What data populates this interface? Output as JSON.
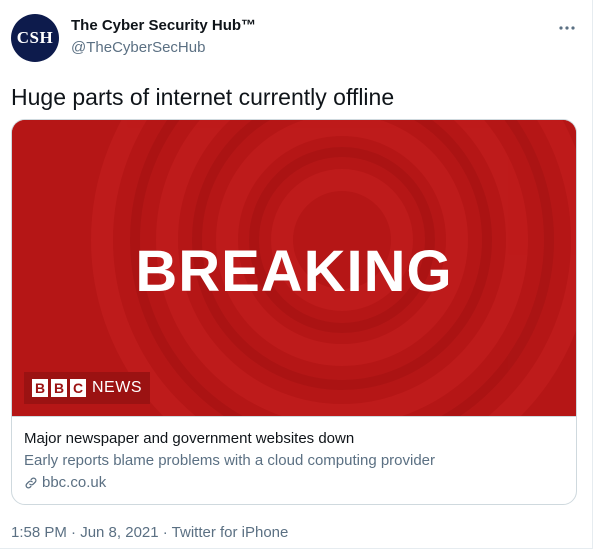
{
  "author": {
    "avatar_text": "CSH",
    "name": "The Cyber Security Hub™",
    "handle": "@TheCyberSecHub"
  },
  "more_icon": "more-horizontal-icon",
  "tweet": {
    "text": "Huge parts of internet currently offline"
  },
  "card": {
    "image_headline": "BREAKING",
    "logo_letters": [
      "B",
      "B",
      "C"
    ],
    "logo_word": "NEWS",
    "title": "Major newspaper and government websites down",
    "description": "Early reports blame problems with a cloud computing provider",
    "domain": "bbc.co.uk",
    "link_icon": "link-icon"
  },
  "meta": {
    "timestamp": "1:58 PM · Jun 8, 2021 · Twitter for iPhone"
  },
  "colors": {
    "avatar_bg": "#0d1b4c",
    "bbc_red": "#bb1919",
    "secondary_text": "#5b7083",
    "border": "#cfd9de"
  }
}
